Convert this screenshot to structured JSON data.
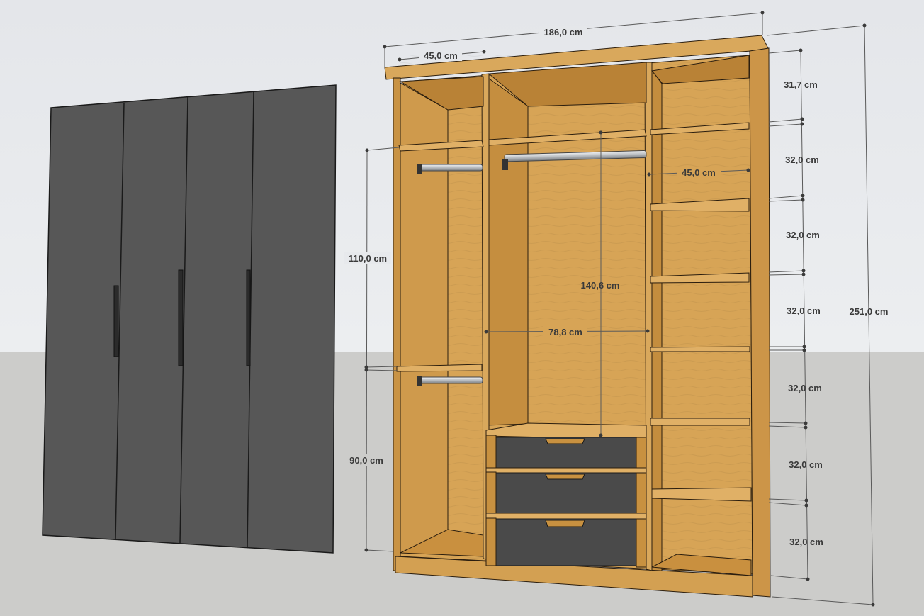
{
  "colors": {
    "sky": "#e7e9ec",
    "ground": "#ccccca",
    "door_panel": "#575757",
    "wood_light": "#d7a456",
    "wood_mid": "#c89140",
    "wood_dark": "#a97432",
    "drawer_front": "#4a4a4a",
    "rail": "#c8ccd0"
  },
  "icons": {
    "door_handle": "vertical-bar-handle",
    "drawer_handle": "recessed-pull-handle"
  },
  "dimensions": {
    "overall_width": "186,0 cm",
    "overall_height": "251,0 cm",
    "left_section_width": "45,0 cm",
    "right_section_width": "45,0 cm",
    "middle_section_width": "78,8 cm",
    "middle_hanging_height": "140,6 cm",
    "left_upper_hanging": "110,0 cm",
    "left_lower_hanging": "90,0 cm",
    "right_shelf_spacings": [
      "31,7 cm",
      "32,0 cm",
      "32,0 cm",
      "32,0 cm",
      "32,0 cm",
      "32,0 cm",
      "32,0 cm"
    ]
  },
  "doors": {
    "count": 4
  },
  "drawers": {
    "count": 3
  }
}
